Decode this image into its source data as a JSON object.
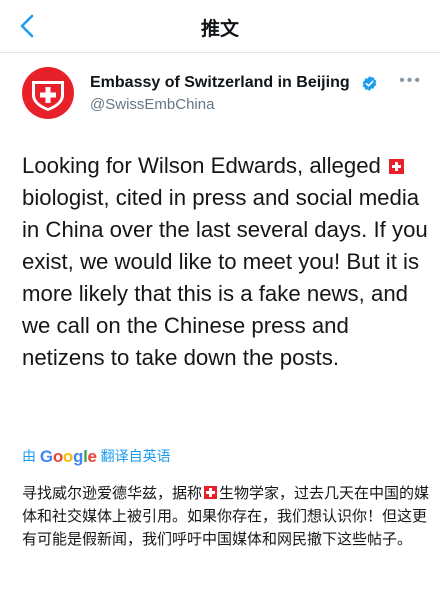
{
  "header": {
    "title": "推文",
    "back_icon": "chevron-left-icon"
  },
  "author": {
    "display_name": "Embassy of Switzerland in Beijing",
    "handle": "@SwissEmbChina",
    "avatar_icon": "swiss-cross-icon",
    "verified_icon": "verified-badge-icon"
  },
  "tweet": {
    "text_before_flag": "Looking for Wilson Edwards, alleged",
    "text_after_flag": "biologist, cited in press and social media in China over the last several days. If you exist, we would like to meet you! But it is more likely that this is a fake news, and we call on the Chinese press and netizens to take down the posts."
  },
  "translation": {
    "prefix": "由",
    "brand": "Google",
    "suffix": "翻译自英语",
    "text_before_flag": "寻找威尔逊爱德华兹，据称",
    "text_after_flag": "生物学家，过去几天在中国的媒体和社交媒体上被引用。如果你存在，我们想认识你！但这更有可能是假新闻，我们呼吁中国媒体和网民撤下这些帖子。"
  },
  "colors": {
    "accent": "#1d9bf0",
    "swiss_red": "#e8202a",
    "secondary_text": "#657786"
  }
}
